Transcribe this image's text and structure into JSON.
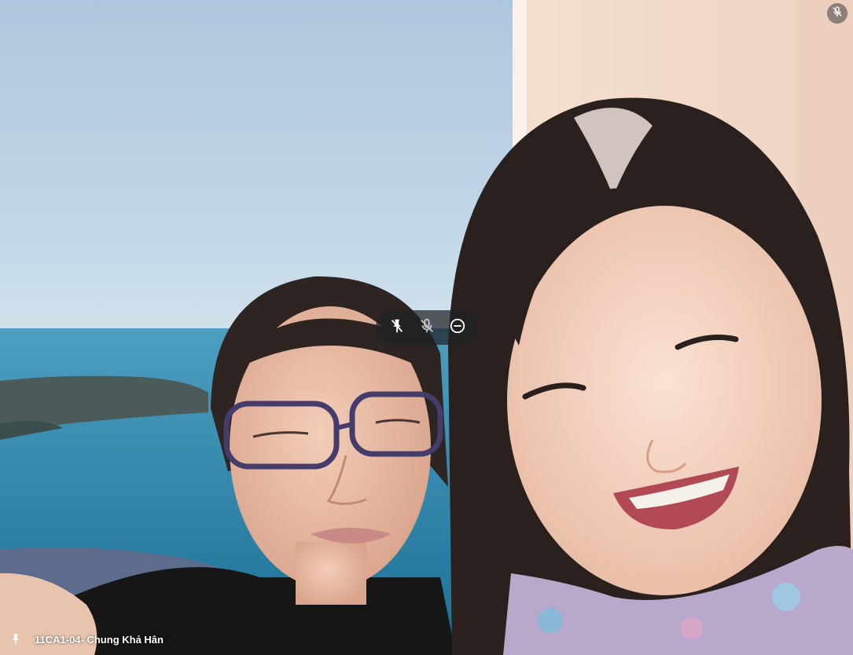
{
  "participant": {
    "name": "11CA1-04- Chung Khả Hân",
    "mic_state": "muted",
    "pinned": true
  },
  "tile_controls": {
    "icons": [
      "unpin-icon",
      "mic-off-icon",
      "remove-icon"
    ]
  },
  "colors": {
    "sky": "#b4cde2",
    "sea": "#2c84a6",
    "wall": "#f1d9c8",
    "control_bg": "#202124",
    "name_text": "#ffffff"
  }
}
